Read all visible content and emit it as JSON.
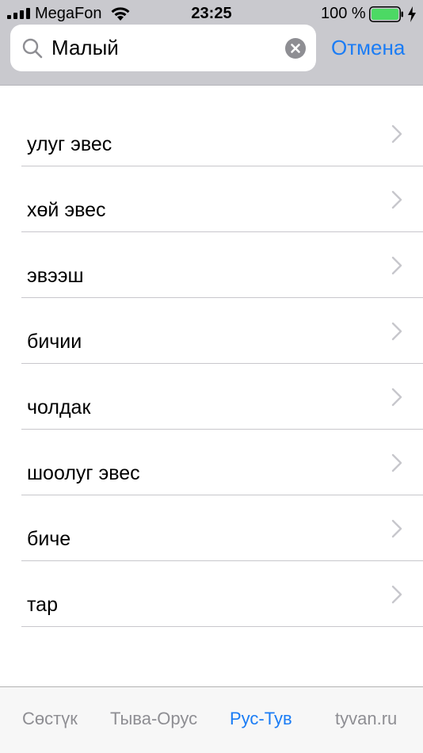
{
  "status_bar": {
    "carrier": "MegaFon",
    "time": "23:25",
    "battery_percent": "100 %",
    "battery_level": 1.0,
    "icons": [
      "signal-bars-icon",
      "wifi-icon",
      "battery-icon",
      "charging-bolt-icon"
    ]
  },
  "search": {
    "value": "Малый",
    "cancel_label": "Отмена",
    "icons": [
      "magnifier-icon",
      "clear-icon"
    ]
  },
  "results": [
    {
      "label": "улуг эвес"
    },
    {
      "label": "хөй эвес"
    },
    {
      "label": "эвээш"
    },
    {
      "label": "бичии"
    },
    {
      "label": "чолдак"
    },
    {
      "label": "шоолуг эвес"
    },
    {
      "label": "биче"
    },
    {
      "label": "тар"
    }
  ],
  "tabs": [
    {
      "label": "Сөстүк",
      "active": false
    },
    {
      "label": "Тыва-Орус",
      "active": false
    },
    {
      "label": "Рус-Тув",
      "active": true
    },
    {
      "label": "tyvan.ru",
      "active": false
    }
  ],
  "colors": {
    "accent": "#1a7cf5",
    "header_bg": "#c9c9ce",
    "battery_fill": "#4cd964",
    "inactive_tab": "#8e8e93",
    "separator": "#c8c7cc"
  }
}
